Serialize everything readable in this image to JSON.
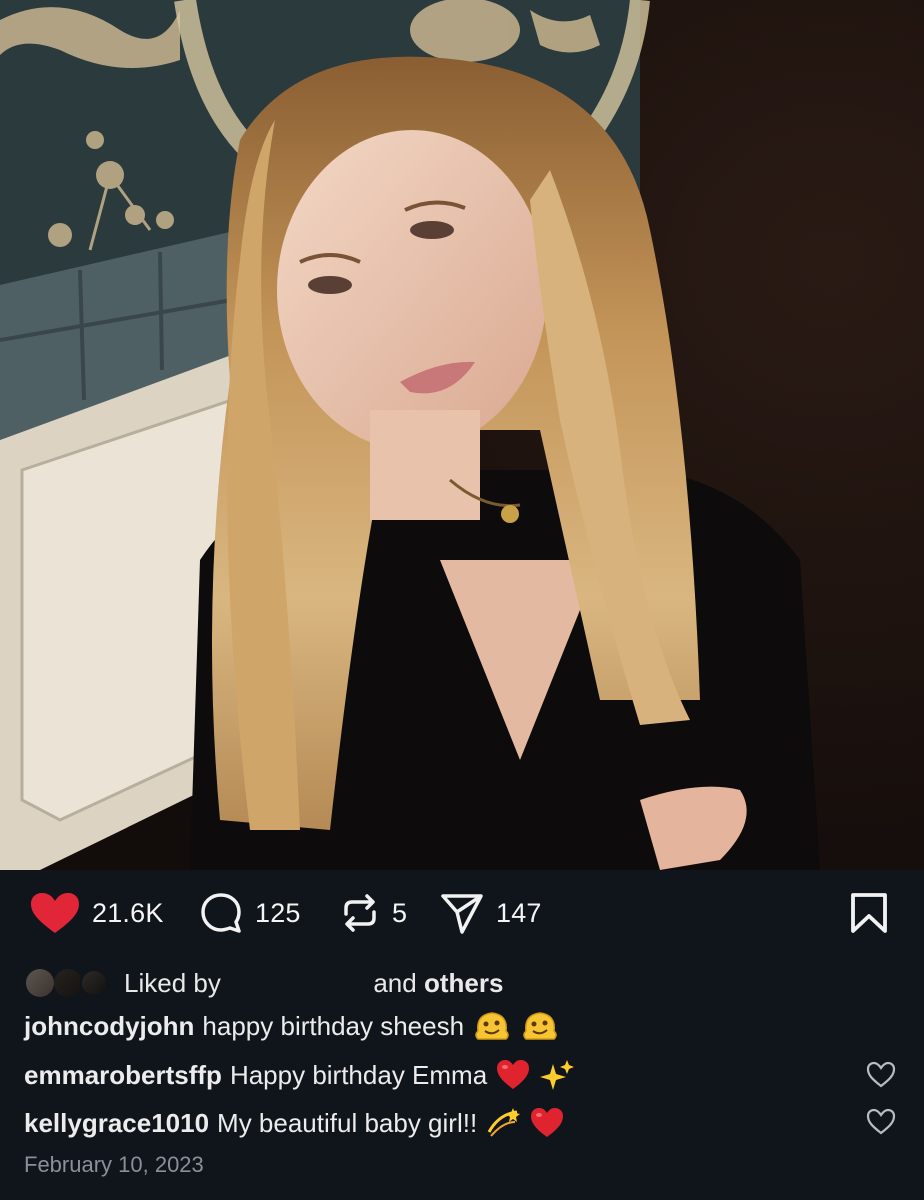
{
  "post": {
    "image_alt": "Photo of a woman with long blonde hair in a black top",
    "likes_count": "21.6K",
    "comments_count": "125",
    "reposts_count": "5",
    "shares_count": "147",
    "liked_by_prefix": "Liked by",
    "liked_by_and": "and",
    "liked_by_others": "others",
    "date": "February 10, 2023"
  },
  "comments": [
    {
      "user": "johncodyjohn",
      "text": "happy birthday sheesh",
      "emojis": [
        "melting-face",
        "melting-face"
      ]
    },
    {
      "user": "emmarobertsffp",
      "text": "Happy birthday Emma",
      "emojis": [
        "red-heart",
        "sparkles"
      ]
    },
    {
      "user": "kellygrace1010",
      "text": "My beautiful baby girl!!",
      "emojis": [
        "dizzy",
        "red-heart"
      ]
    }
  ],
  "icons": {
    "like": "heart-filled-icon",
    "comment": "speech-bubble-icon",
    "repost": "repost-arrows-icon",
    "share": "paper-plane-icon",
    "save": "bookmark-icon",
    "comment_like": "heart-outline-icon"
  },
  "colors": {
    "background": "#0f151b",
    "like_red": "#e02637",
    "text_primary": "#f2f2f2",
    "text_secondary": "#8a9097"
  }
}
